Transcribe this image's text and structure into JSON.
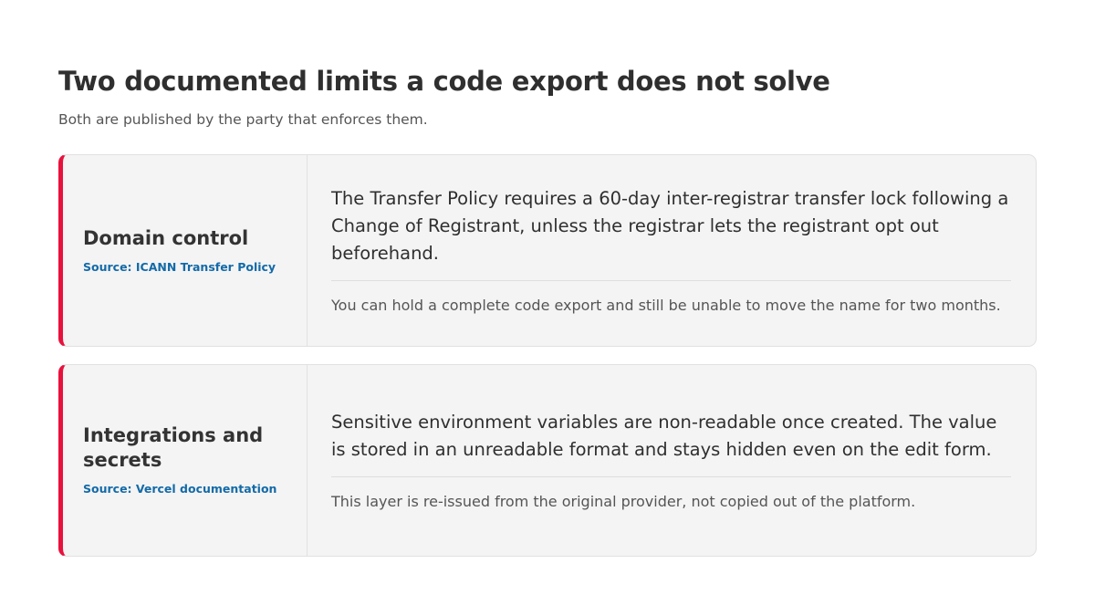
{
  "header": {
    "title": "Two documented limits a code export does not solve",
    "subtitle": "Both are published by the party that enforces them."
  },
  "cards": [
    {
      "title": "Domain control",
      "source": "Source: ICANN Transfer Policy",
      "statement": "The Transfer Policy requires a 60-day inter-registrar transfer lock following a Change of Registrant, unless the registrar lets the registrant opt out beforehand.",
      "note": "You can hold a complete code export and still be unable to move the name for two months."
    },
    {
      "title": "Integrations and secrets",
      "source": "Source: Vercel documentation",
      "statement": "Sensitive environment variables are non-readable once created. The value is stored in an unreadable format and stays hidden even on the edit form.",
      "note": "This layer is re-issued from the original provider, not copied out of the platform."
    }
  ],
  "colors": {
    "accent": "#e8123d",
    "source_link": "#136aa8",
    "card_background": "#f4f4f4"
  }
}
